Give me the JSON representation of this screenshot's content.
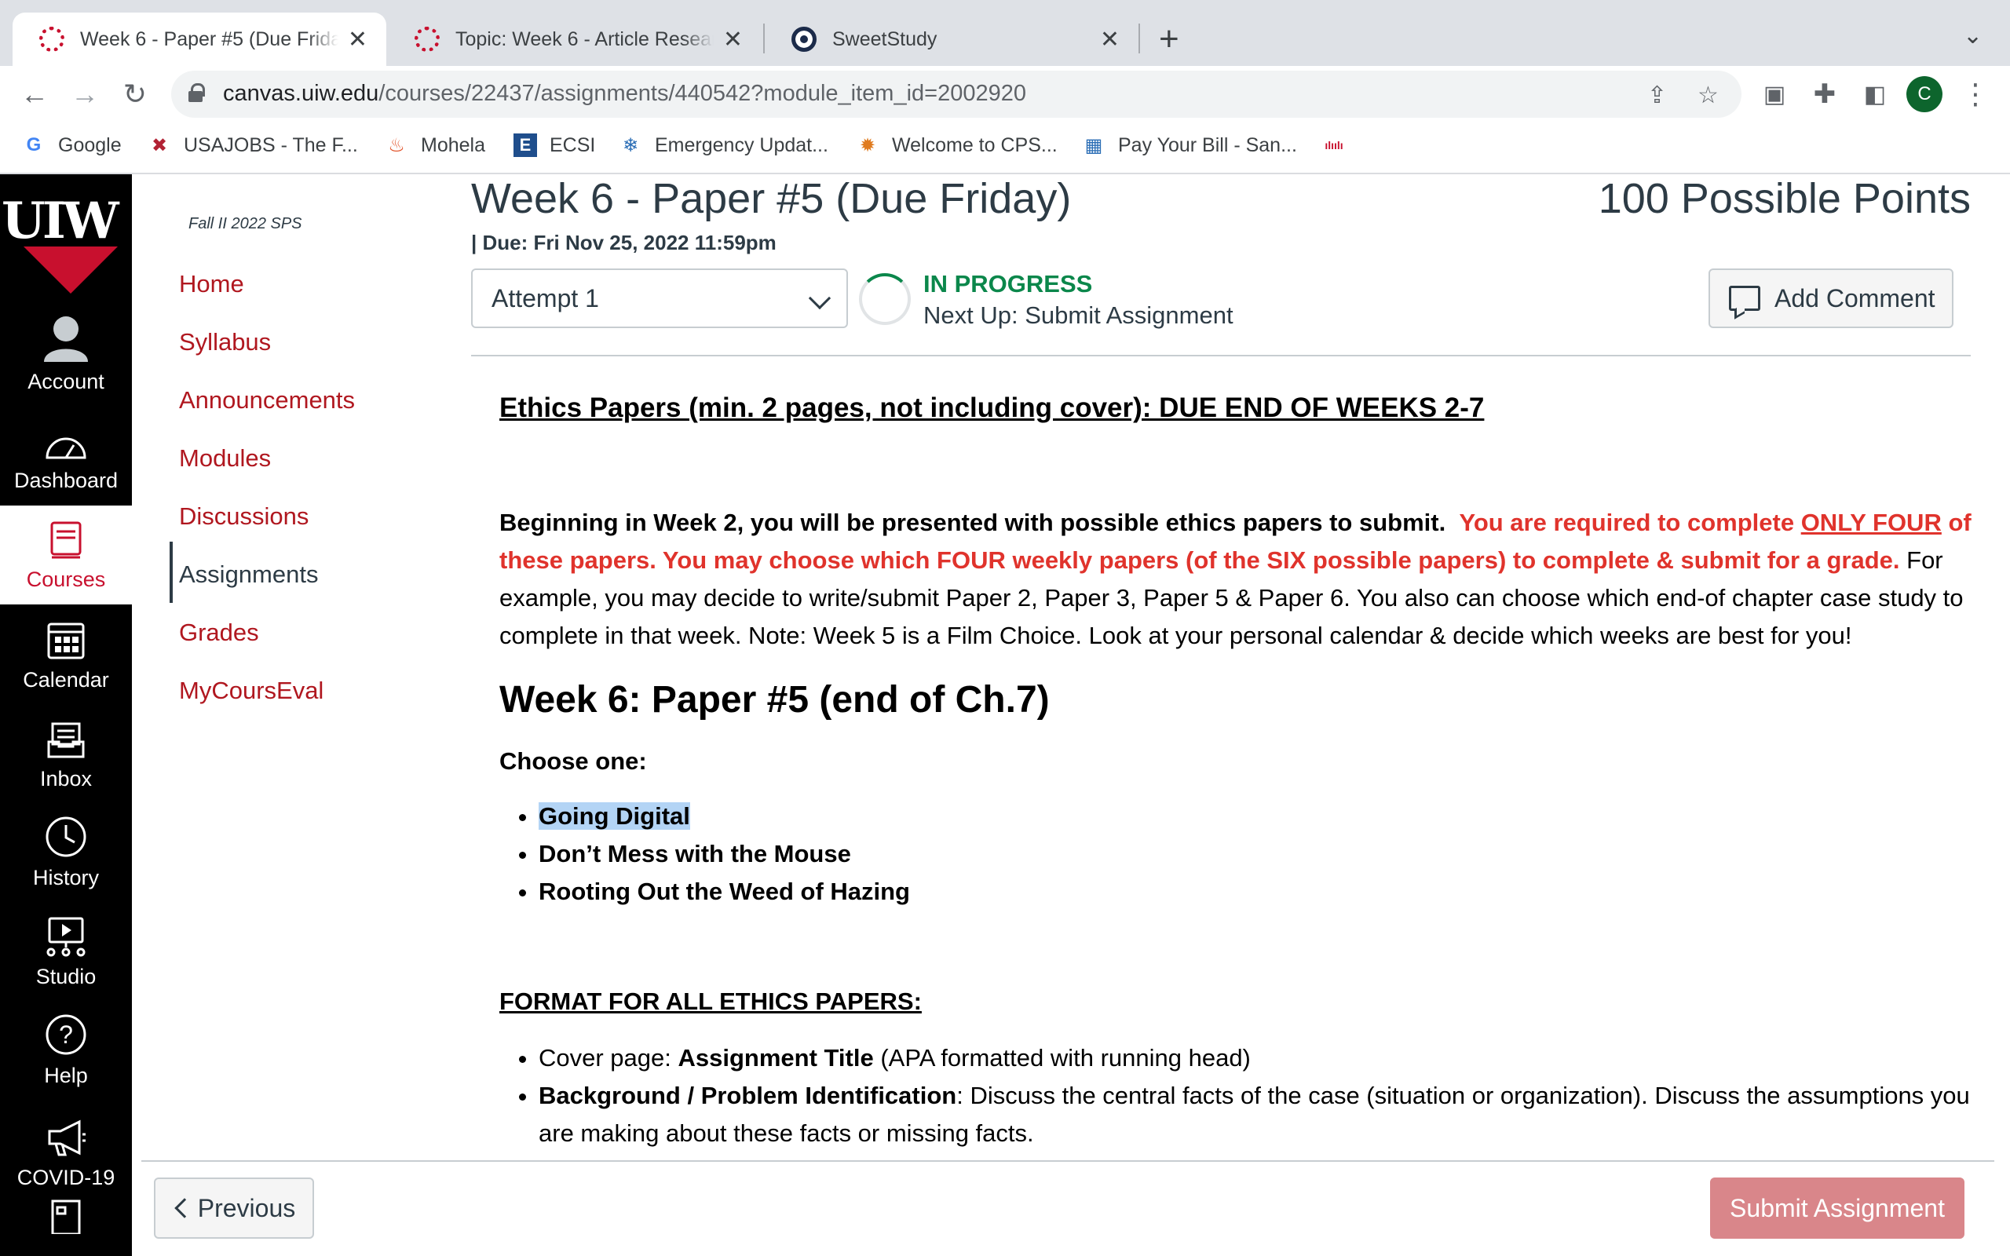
{
  "browser": {
    "tabs": [
      {
        "title": "Week 6 - Paper #5 (Due Friday)",
        "active": true,
        "icon": "uiw-icon"
      },
      {
        "title": "Topic: Week 6 - Article Research",
        "active": false,
        "icon": "uiw-icon"
      },
      {
        "title": "SweetStudy",
        "active": false,
        "icon": "sweetstudy-icon"
      }
    ],
    "url_host": "canvas.uiw.edu",
    "url_path": "/courses/22437/assignments/440542?module_item_id=2002920",
    "profile_initial": "C",
    "bookmarks": [
      "Google",
      "USAJOBS - The F...",
      "Mohela",
      "ECSI",
      "Emergency Updat...",
      "Welcome to CPS...",
      "Pay Your Bill - San..."
    ]
  },
  "global_nav": {
    "logo_text": "UIW",
    "items": [
      "Account",
      "Dashboard",
      "Courses",
      "Calendar",
      "Inbox",
      "History",
      "Studio",
      "Help",
      "COVID-19"
    ],
    "active": "Courses"
  },
  "course_nav": {
    "term": "Fall II 2022 SPS",
    "items": [
      "Home",
      "Syllabus",
      "Announcements",
      "Modules",
      "Discussions",
      "Assignments",
      "Grades",
      "MyCoursEval"
    ],
    "active": "Assignments"
  },
  "assignment": {
    "title": "Week 6 - Paper #5 (Due Friday)",
    "points": "100 Possible Points",
    "due": "| Due: Fri Nov 25, 2022 11:59pm",
    "attempt": "Attempt 1",
    "status": "IN PROGRESS",
    "next_up": "Next Up: Submit Assignment",
    "add_comment": "Add Comment"
  },
  "content": {
    "heading": "Ethics Papers (min. 2 pages, not including cover): DUE END OF WEEKS 2-7",
    "p1_bold": "Beginning in Week 2, you will be presented with possible ethics papers to submit.",
    "p1_red1": "You are required to complete ",
    "p1_red_ul": "ONLY FOUR",
    "p1_red2": " of these papers.  You may choose which FOUR weekly papers (of the SIX possible papers) to complete & submit for a grade.",
    "p1_normal": "  For example, you may decide to write/submit Paper 2, Paper 3, Paper 5 & Paper 6. You also can choose which end-of chapter case study to complete in that week. Note: Week 5 is a Film Choice.  Look at your personal calendar & decide which weeks are best for you!",
    "week_heading": "Week 6: Paper #5 (end of Ch.7)",
    "choose": "Choose one:",
    "options": [
      "Going Digital",
      "Don’t Mess with the Mouse",
      "Rooting Out the Weed of Hazing"
    ],
    "format_heading": "FORMAT FOR ALL ETHICS PAPERS:",
    "fmt1_label": "Cover page: ",
    "fmt1_bold": "Assignment Title",
    "fmt1_rest": " (APA formatted with running head)",
    "fmt2_bold": "Background / Problem Identification",
    "fmt2_rest": ": Discuss the central facts of the case (situation or organization). Discuss the assumptions you are making about these facts or missing facts."
  },
  "footer": {
    "previous": "Previous",
    "submit": "Submit Assignment"
  },
  "colors": {
    "canvas_red": "#b0171f",
    "status_green": "#0b874b",
    "alert_red": "#e0332c",
    "submit_disabled": "#d9868a"
  }
}
